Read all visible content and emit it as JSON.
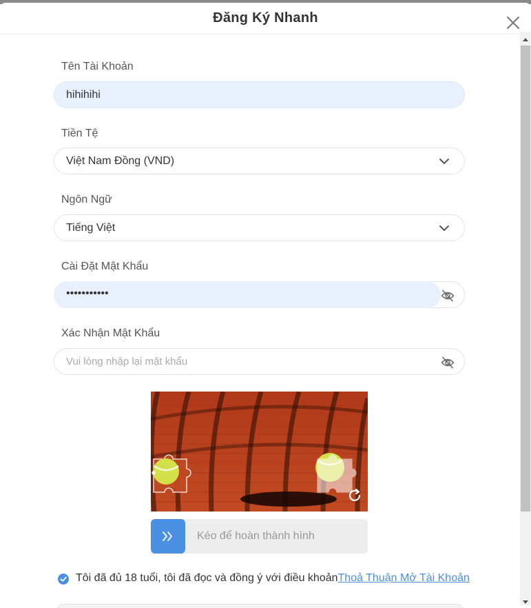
{
  "modal": {
    "title": "Đăng Ký Nhanh"
  },
  "form": {
    "username": {
      "label": "Tên Tài Khoản",
      "value": "hihihihi"
    },
    "currency": {
      "label": "Tiền Tệ",
      "value": "Việt Nam Đồng (VND)"
    },
    "language": {
      "label": "Ngôn Ngữ",
      "value": "Tiếng Việt"
    },
    "password": {
      "label": "Cài Đặt Mật Khẩu",
      "value": "•••••••••••"
    },
    "confirm_password": {
      "label": "Xác Nhận Mật Khẩu",
      "placeholder": "Vui lòng nhập lại mật khẩu"
    }
  },
  "captcha": {
    "slider_hint": "Kéo để hoàn thành hình"
  },
  "terms": {
    "text": "Tôi đã đủ 18 tuổi, tôi đã đọc và đồng ý với điều khoản",
    "link": "Thoả Thuận Mở Tài Khoản",
    "checked": true
  },
  "icons": {
    "close": "close-icon",
    "dropdown": "chevron-down-icon",
    "password_toggle": "eye-off-icon",
    "refresh": "refresh-icon",
    "slider": "double-chevron-right-icon",
    "check": "check-circle-icon"
  },
  "colors": {
    "accent": "#4a90e2",
    "autofill_bg": "#e8f0fe",
    "captcha_bg": "#b8401c"
  }
}
